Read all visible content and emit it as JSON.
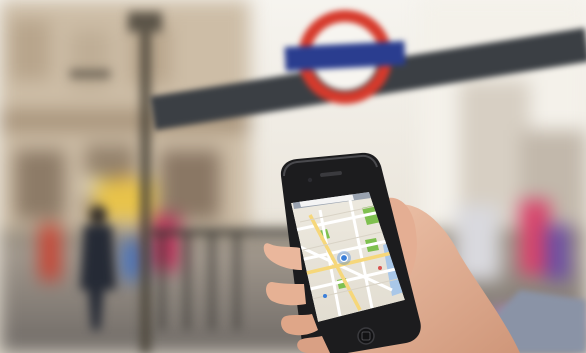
{
  "photo": {
    "subject": "hand-holding-smartphone-with-map",
    "colors": {
      "sky": "#f3f1ec",
      "building": "#c9b9a2",
      "roundel_red": "#d63a2c",
      "roundel_bar": "#2a3d8f",
      "phone_body": "#1c1c1e",
      "map_land": "#e9e5dc",
      "map_park": "#7fc04f",
      "map_road": "#ffffff",
      "map_road_major": "#f6d77a",
      "map_water": "#a9c7e8",
      "pin_blue": "#3b7fd9",
      "skin": "#e8b9a0",
      "sleeve": "#8a93a6"
    },
    "phone_screen": {
      "app": "maps",
      "status_bar": "visible",
      "search_bar": "visible"
    }
  }
}
